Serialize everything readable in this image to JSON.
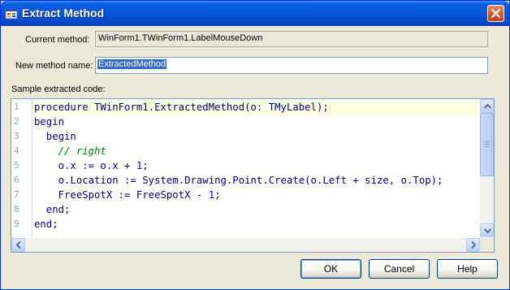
{
  "window": {
    "title": "Extract Method",
    "close_glyph": "close-icon"
  },
  "form": {
    "current_method_label": "Current method:",
    "current_method_value": "WinForm1.TWinForm1.LabelMouseDown",
    "new_method_label": "New method name:",
    "new_method_value": "ExtractedMethod",
    "sample_label": "Sample extracted code:"
  },
  "code": {
    "line_numbers": [
      "1",
      "2",
      "3",
      "4",
      "5",
      "6",
      "7",
      "8",
      "9"
    ],
    "lines": [
      "procedure TWinForm1.ExtractedMethod(o: TMyLabel);",
      "begin",
      "  begin",
      "    // right",
      "    o.x := o.x + 1;",
      "    o.Location := System.Drawing.Point.Create(o.Left + size, o.Top);",
      "    FreeSpotX := FreeSpotX - 1;",
      "  end;",
      "end;"
    ]
  },
  "buttons": {
    "ok": "OK",
    "cancel": "Cancel",
    "help": "Help"
  },
  "colors": {
    "titlebar": "#0757d8",
    "keyword": "#000080",
    "comment": "#008000",
    "number": "#0000ff",
    "selection": "#316ac5"
  }
}
